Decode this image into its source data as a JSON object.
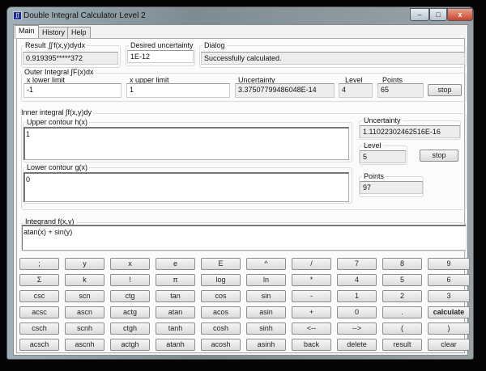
{
  "window": {
    "title": "Double Integral Calculator Level 2",
    "icon": "app-icon",
    "controls": [
      "minimize",
      "maximize",
      "close"
    ]
  },
  "tabs": [
    {
      "label": "Main",
      "active": true
    },
    {
      "label": "History"
    },
    {
      "label": "Help"
    }
  ],
  "result": {
    "label": "Result  ∬f(x,y)dydx",
    "value": "0.919395*****372"
  },
  "desired": {
    "label": "Desired uncertainty",
    "value": "1E-12"
  },
  "dialog": {
    "label": "Dialog",
    "value": "Successfully calculated."
  },
  "outer": {
    "label": "Outer Integral  ∫F(x)dx",
    "lower_label": "x lower limit",
    "lower": "-1",
    "upper_label": "x upper limit",
    "upper": "1",
    "unc_label": "Uncertainty",
    "unc": "3.37507799486048E-14",
    "level_label": "Level",
    "level": "4",
    "points_label": "Points",
    "points": "65",
    "stop": "stop"
  },
  "inner": {
    "label": "Inner integral  ∫f(x,y)dy",
    "upper_label": "Upper contour h(x)",
    "upper": "1",
    "lower_label": "Lower contour g(x)",
    "lower": "0",
    "unc_label": "Uncertainty",
    "unc": "1.11022302462516E-16",
    "level_label": "Level",
    "level": "5",
    "stop": "stop",
    "points_label": "Points",
    "points": "97"
  },
  "integrand": {
    "label": "Integrand f(x,y)",
    "value": "atan(x) + sin(y)"
  },
  "keypad": [
    [
      ";",
      "y",
      "x",
      "e",
      "E",
      "^",
      "/",
      "7",
      "8",
      "9"
    ],
    [
      "Σ",
      "k",
      "!",
      "π",
      "log",
      "ln",
      "*",
      "4",
      "5",
      "6"
    ],
    [
      "csc",
      "scn",
      "ctg",
      "tan",
      "cos",
      "sin",
      "-",
      "1",
      "2",
      "3"
    ],
    [
      "acsc",
      "ascn",
      "actg",
      "atan",
      "acos",
      "asin",
      "+",
      "0",
      ".",
      "calculate"
    ],
    [
      "csch",
      "scnh",
      "ctgh",
      "tanh",
      "cosh",
      "sinh",
      "<--",
      "-->",
      "(",
      ")"
    ],
    [
      "acsch",
      "ascnh",
      "actgh",
      "atanh",
      "acosh",
      "asinh",
      "back",
      "delete",
      "result",
      "clear"
    ]
  ]
}
